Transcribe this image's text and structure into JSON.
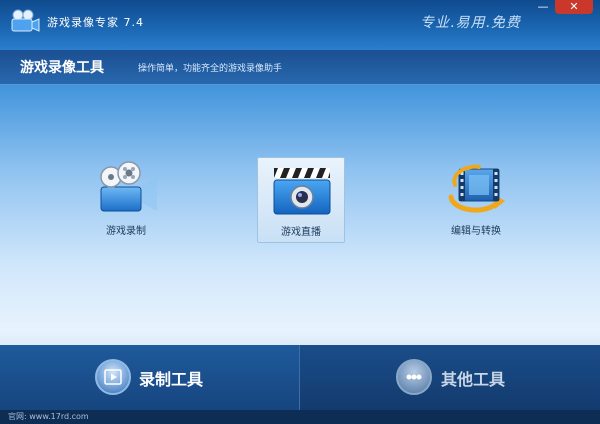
{
  "window": {
    "title": "游戏录像专家 7.4",
    "slogan": "专业.易用.免费",
    "minimize_glyph": "—",
    "close_glyph": "✕"
  },
  "header": {
    "title": "游戏录像工具",
    "subtitle": "操作简单，功能齐全的游戏录像助手"
  },
  "tiles": [
    {
      "label": "游戏录制",
      "icon": "video-camera-icon"
    },
    {
      "label": "游戏直播",
      "icon": "clapperboard-icon",
      "selected": true
    },
    {
      "label": "编辑与转换",
      "icon": "film-convert-icon"
    }
  ],
  "bottom_tabs": [
    {
      "label": "录制工具",
      "icon": "film-play-icon",
      "active": true
    },
    {
      "label": "其他工具",
      "icon": "more-dots-icon",
      "active": false
    }
  ],
  "status": {
    "text": "官网: www.17rd.com"
  },
  "colors": {
    "title_bar": "#1c68b4",
    "header": "#2868ae",
    "bottom_bar": "#133b6e",
    "close_button": "#c9382b"
  }
}
